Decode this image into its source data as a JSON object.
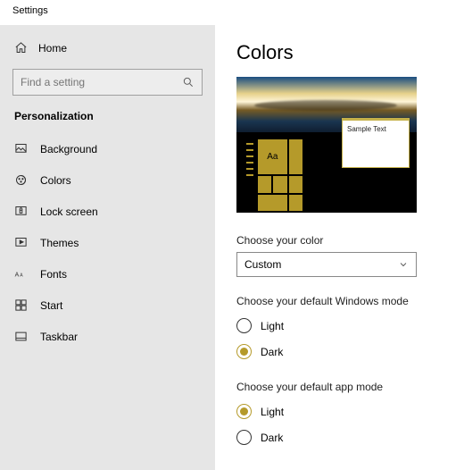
{
  "window": {
    "title": "Settings"
  },
  "sidebar": {
    "home": "Home",
    "search_placeholder": "Find a setting",
    "section": "Personalization",
    "items": [
      {
        "label": "Background"
      },
      {
        "label": "Colors"
      },
      {
        "label": "Lock screen"
      },
      {
        "label": "Themes"
      },
      {
        "label": "Fonts"
      },
      {
        "label": "Start"
      },
      {
        "label": "Taskbar"
      }
    ]
  },
  "main": {
    "title": "Colors",
    "preview": {
      "sample_text": "Sample Text",
      "tile_glyph": "Aa"
    },
    "choose_color": {
      "label": "Choose your color",
      "selected": "Custom"
    },
    "windows_mode": {
      "label": "Choose your default Windows mode",
      "options": {
        "light": "Light",
        "dark": "Dark"
      },
      "selected": "dark"
    },
    "app_mode": {
      "label": "Choose your default app mode",
      "options": {
        "light": "Light",
        "dark": "Dark"
      },
      "selected": "light"
    },
    "accent_color": "#b59a2a"
  }
}
